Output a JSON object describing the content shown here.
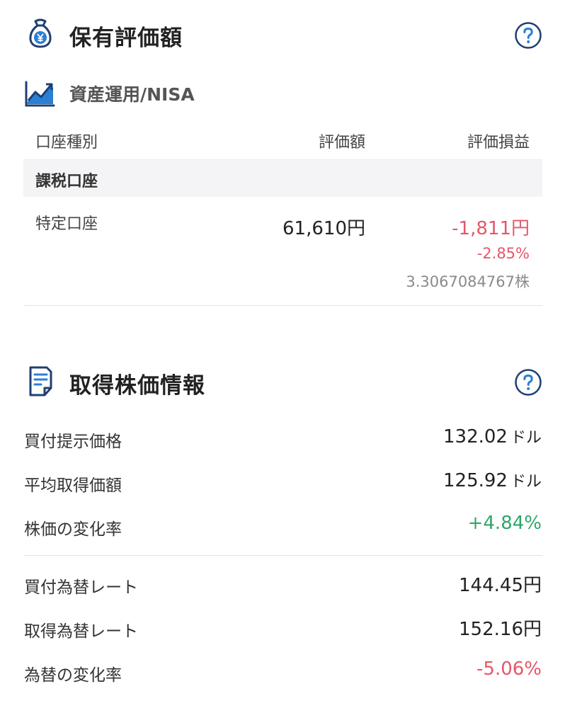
{
  "holdings": {
    "title": "保有評価額",
    "icons": {
      "section": "money-bag-yen-icon",
      "help": "question-circle-icon",
      "subsection": "line-chart-icon"
    },
    "subsection_title": "資産運用/NISA",
    "columns": {
      "type": "口座種別",
      "value": "評価額",
      "pl": "評価損益"
    },
    "group_label": "課税口座",
    "account": {
      "name": "特定口座",
      "value": "61,610円",
      "pl": "-1,811円",
      "pl_pct": "-2.85%",
      "shares": "3.3067084767株"
    }
  },
  "acquisition": {
    "title": "取得株価情報",
    "icons": {
      "section": "document-icon",
      "help": "question-circle-icon"
    },
    "stock_rows": [
      {
        "label": "買付提示価格",
        "value": "132.02",
        "unit": "ドル"
      },
      {
        "label": "平均取得価額",
        "value": "125.92",
        "unit": "ドル"
      },
      {
        "label": "株価の変化率",
        "value": "+4.84%",
        "unit": ""
      }
    ],
    "fx_rows": [
      {
        "label": "買付為替レート",
        "value": "144.45円",
        "unit": ""
      },
      {
        "label": "取得為替レート",
        "value": "152.16円",
        "unit": ""
      },
      {
        "label": "為替の変化率",
        "value": "-5.06%",
        "unit": ""
      }
    ]
  },
  "colors": {
    "accent": "#1f3f73",
    "icon_blue": "#2b7fd4",
    "negative": "#e5576a",
    "positive": "#2fa56b"
  }
}
